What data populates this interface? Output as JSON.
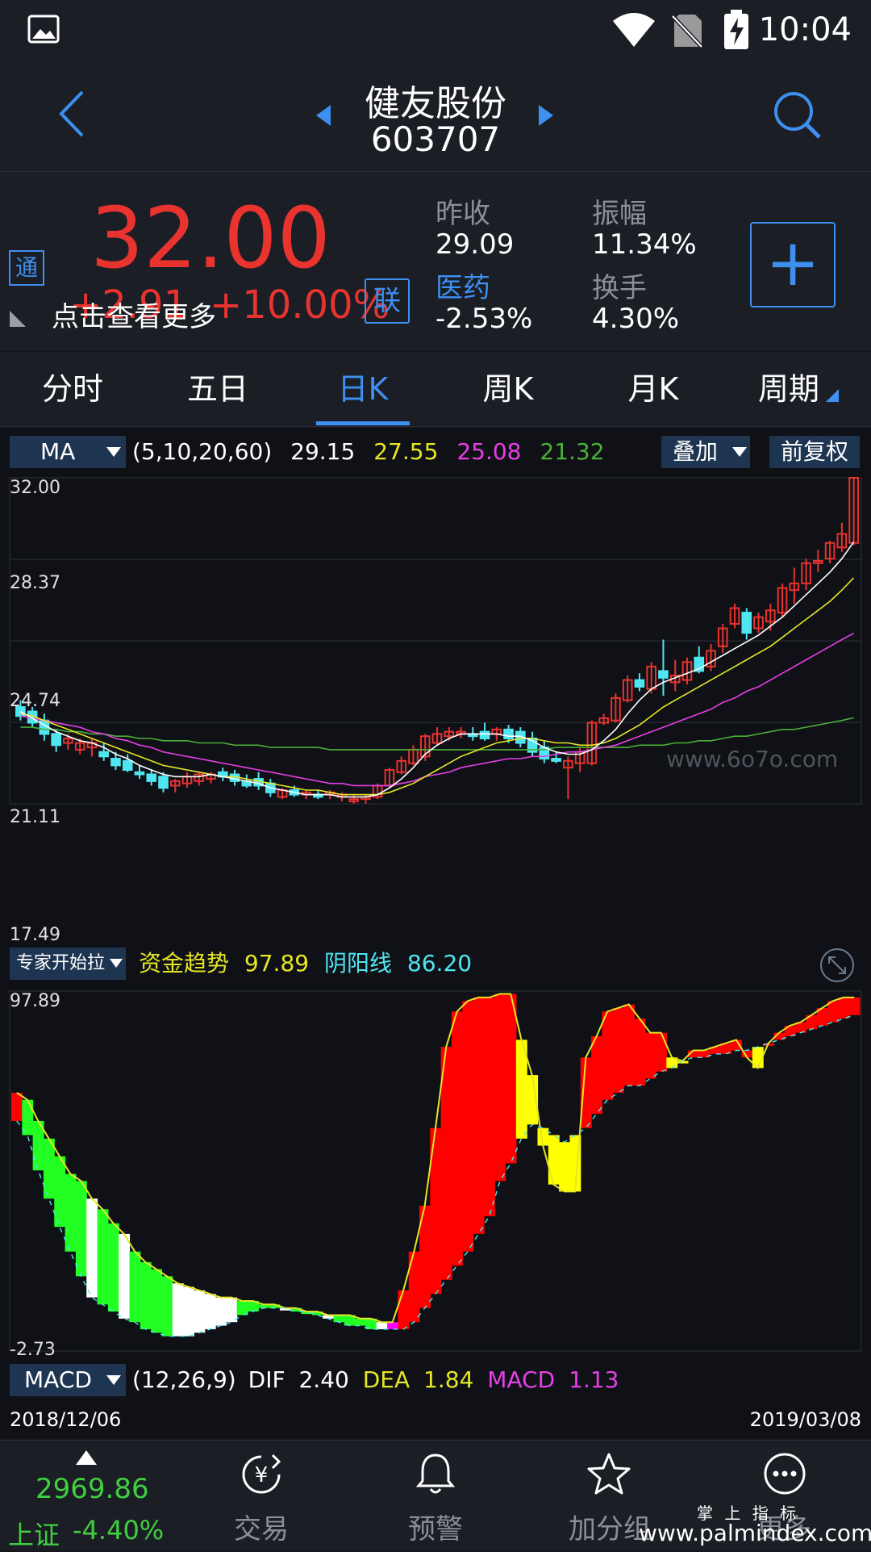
{
  "status_bar": {
    "time": "10:04"
  },
  "header": {
    "stock_name": "健友股份",
    "stock_code": "603707"
  },
  "quote": {
    "tong_badge": "通",
    "price": "32.00",
    "change": "+2.91",
    "change_pct": "+10.00%",
    "more_hint": "点击查看更多",
    "lian_badge": "联",
    "prev_close_label": "昨收",
    "prev_close": "29.09",
    "sector_label": "医药",
    "sector_change": "-2.53%",
    "amplitude_label": "振幅",
    "amplitude": "11.34%",
    "turnover_label": "换手",
    "turnover": "4.30%",
    "add_symbol": "+"
  },
  "tabs": [
    {
      "label": "分时"
    },
    {
      "label": "五日"
    },
    {
      "label": "日K"
    },
    {
      "label": "周K"
    },
    {
      "label": "月K"
    },
    {
      "label": "周期"
    }
  ],
  "ma_bar": {
    "indicator": "MA",
    "params": "(5,10,20,60)",
    "ma5": "29.15",
    "ma10": "27.55",
    "ma20": "25.08",
    "ma60": "21.32",
    "overlay_label": "叠加",
    "adjust_label": "前复权"
  },
  "colors": {
    "up": "#e8332f",
    "down": "#4fe6f2",
    "ma5": "#ffffff",
    "ma10": "#e6e625",
    "ma20": "#e63fe6",
    "ma60": "#4caf38",
    "accent": "#3d8ff0"
  },
  "price_axis": {
    "top": "32.00",
    "upper_mid": "28.37",
    "lower_mid": "24.74",
    "mid": "21.11",
    "bottom": "17.49"
  },
  "watermark": "www.6o7o.com",
  "indicator2": {
    "name": "专家开始拉",
    "trend_label": "资金趋势",
    "trend_value": "97.89",
    "yinyang_label": "阴阳线",
    "yinyang_value": "86.20",
    "axis_top": "97.89",
    "axis_bottom": "-2.73"
  },
  "macd_bar": {
    "indicator": "MACD",
    "params": "(12,26,9)",
    "dif_label": "DIF",
    "dif": "2.40",
    "dea_label": "DEA",
    "dea": "1.84",
    "macd_label": "MACD",
    "macd": "1.13"
  },
  "date_range": {
    "start": "2018/12/06",
    "end": "2019/03/08"
  },
  "bottom_nav": {
    "index_value": "2969.86",
    "index_name": "上证",
    "index_change": "-4.40%",
    "items": [
      {
        "label": "交易"
      },
      {
        "label": "预警"
      },
      {
        "label": "加分组"
      },
      {
        "label": "更多"
      }
    ]
  },
  "footer_watermark": {
    "line1": "掌 上 指 标",
    "line2": "www.palmindex.com"
  },
  "chart_data": {
    "type": "candlestick",
    "ylim": [
      17.49,
      32.0
    ],
    "candles": [
      {
        "o": 21.8,
        "h": 22.1,
        "l": 21.2,
        "c": 21.4
      },
      {
        "o": 21.6,
        "h": 21.8,
        "l": 20.9,
        "c": 21.1
      },
      {
        "o": 21.2,
        "h": 21.5,
        "l": 20.3,
        "c": 20.6
      },
      {
        "o": 20.6,
        "h": 20.8,
        "l": 19.8,
        "c": 20.1
      },
      {
        "o": 20.2,
        "h": 20.6,
        "l": 19.9,
        "c": 20.4
      },
      {
        "o": 19.9,
        "h": 20.4,
        "l": 19.7,
        "c": 20.2
      },
      {
        "o": 20.0,
        "h": 20.4,
        "l": 19.6,
        "c": 20.2
      },
      {
        "o": 19.8,
        "h": 20.2,
        "l": 19.4,
        "c": 19.6
      },
      {
        "o": 19.5,
        "h": 19.8,
        "l": 19.0,
        "c": 19.2
      },
      {
        "o": 19.4,
        "h": 19.7,
        "l": 18.9,
        "c": 19.0
      },
      {
        "o": 18.9,
        "h": 19.2,
        "l": 18.6,
        "c": 18.8
      },
      {
        "o": 18.8,
        "h": 19.0,
        "l": 18.3,
        "c": 18.5
      },
      {
        "o": 18.7,
        "h": 18.9,
        "l": 18.0,
        "c": 18.2
      },
      {
        "o": 18.3,
        "h": 18.6,
        "l": 18.0,
        "c": 18.5
      },
      {
        "o": 18.4,
        "h": 18.9,
        "l": 18.2,
        "c": 18.7
      },
      {
        "o": 18.5,
        "h": 18.9,
        "l": 18.3,
        "c": 18.8
      },
      {
        "o": 18.6,
        "h": 18.9,
        "l": 18.4,
        "c": 18.8
      },
      {
        "o": 18.9,
        "h": 19.1,
        "l": 18.5,
        "c": 18.7
      },
      {
        "o": 18.8,
        "h": 19.0,
        "l": 18.3,
        "c": 18.5
      },
      {
        "o": 18.5,
        "h": 18.8,
        "l": 18.2,
        "c": 18.3
      },
      {
        "o": 18.6,
        "h": 18.9,
        "l": 18.1,
        "c": 18.3
      },
      {
        "o": 18.4,
        "h": 18.6,
        "l": 17.8,
        "c": 18.0
      },
      {
        "o": 17.8,
        "h": 18.2,
        "l": 17.7,
        "c": 18.1
      },
      {
        "o": 18.1,
        "h": 18.3,
        "l": 17.8,
        "c": 17.9
      },
      {
        "o": 17.9,
        "h": 18.1,
        "l": 17.7,
        "c": 18.0
      },
      {
        "o": 17.9,
        "h": 18.1,
        "l": 17.7,
        "c": 17.8
      },
      {
        "o": 17.9,
        "h": 18.1,
        "l": 17.7,
        "c": 18.0
      },
      {
        "o": 17.8,
        "h": 18.0,
        "l": 17.6,
        "c": 17.9
      },
      {
        "o": 17.6,
        "h": 17.9,
        "l": 17.5,
        "c": 17.7
      },
      {
        "o": 17.7,
        "h": 17.9,
        "l": 17.5,
        "c": 17.8
      },
      {
        "o": 17.8,
        "h": 18.4,
        "l": 17.7,
        "c": 18.3
      },
      {
        "o": 18.3,
        "h": 19.1,
        "l": 18.2,
        "c": 19.0
      },
      {
        "o": 18.9,
        "h": 19.6,
        "l": 18.8,
        "c": 19.4
      },
      {
        "o": 19.3,
        "h": 20.1,
        "l": 19.2,
        "c": 19.9
      },
      {
        "o": 19.6,
        "h": 20.6,
        "l": 19.4,
        "c": 20.5
      },
      {
        "o": 20.2,
        "h": 20.9,
        "l": 20.1,
        "c": 20.6
      },
      {
        "o": 20.5,
        "h": 20.9,
        "l": 20.3,
        "c": 20.7
      },
      {
        "o": 20.6,
        "h": 20.9,
        "l": 20.4,
        "c": 20.7
      },
      {
        "o": 20.6,
        "h": 20.9,
        "l": 20.3,
        "c": 20.5
      },
      {
        "o": 20.7,
        "h": 21.1,
        "l": 20.3,
        "c": 20.4
      },
      {
        "o": 20.6,
        "h": 20.9,
        "l": 20.3,
        "c": 20.8
      },
      {
        "o": 20.8,
        "h": 21.0,
        "l": 20.2,
        "c": 20.4
      },
      {
        "o": 20.7,
        "h": 20.9,
        "l": 20.0,
        "c": 20.2
      },
      {
        "o": 20.4,
        "h": 20.7,
        "l": 19.6,
        "c": 19.8
      },
      {
        "o": 20.0,
        "h": 20.3,
        "l": 19.3,
        "c": 19.5
      },
      {
        "o": 19.5,
        "h": 19.8,
        "l": 19.3,
        "c": 19.4
      },
      {
        "o": 19.1,
        "h": 19.6,
        "l": 17.7,
        "c": 19.4
      },
      {
        "o": 19.3,
        "h": 20.0,
        "l": 18.9,
        "c": 19.8
      },
      {
        "o": 19.3,
        "h": 21.2,
        "l": 19.2,
        "c": 21.1
      },
      {
        "o": 21.1,
        "h": 21.5,
        "l": 21.0,
        "c": 21.3
      },
      {
        "o": 21.2,
        "h": 22.4,
        "l": 21.1,
        "c": 22.2
      },
      {
        "o": 22.1,
        "h": 23.2,
        "l": 22.0,
        "c": 23.0
      },
      {
        "o": 23.0,
        "h": 23.3,
        "l": 22.5,
        "c": 22.7
      },
      {
        "o": 22.6,
        "h": 23.8,
        "l": 22.4,
        "c": 23.6
      },
      {
        "o": 23.4,
        "h": 24.8,
        "l": 22.3,
        "c": 23.1
      },
      {
        "o": 22.9,
        "h": 23.9,
        "l": 22.5,
        "c": 23.2
      },
      {
        "o": 23.0,
        "h": 24.0,
        "l": 22.8,
        "c": 23.8
      },
      {
        "o": 24.0,
        "h": 24.5,
        "l": 23.3,
        "c": 23.4
      },
      {
        "o": 23.6,
        "h": 24.6,
        "l": 23.4,
        "c": 24.3
      },
      {
        "o": 24.5,
        "h": 25.5,
        "l": 24.2,
        "c": 25.3
      },
      {
        "o": 25.5,
        "h": 26.4,
        "l": 25.3,
        "c": 26.2
      },
      {
        "o": 26.0,
        "h": 26.2,
        "l": 24.8,
        "c": 25.1
      },
      {
        "o": 25.3,
        "h": 26.0,
        "l": 25.1,
        "c": 25.8
      },
      {
        "o": 25.6,
        "h": 26.4,
        "l": 25.2,
        "c": 26.1
      },
      {
        "o": 26.0,
        "h": 27.3,
        "l": 25.8,
        "c": 27.1
      },
      {
        "o": 27.0,
        "h": 28.0,
        "l": 26.4,
        "c": 27.3
      },
      {
        "o": 27.3,
        "h": 28.4,
        "l": 27.0,
        "c": 28.2
      },
      {
        "o": 28.2,
        "h": 28.8,
        "l": 27.8,
        "c": 28.3
      },
      {
        "o": 28.4,
        "h": 29.2,
        "l": 28.2,
        "c": 29.1
      },
      {
        "o": 28.9,
        "h": 30.0,
        "l": 28.7,
        "c": 29.5
      },
      {
        "o": 29.1,
        "h": 32.0,
        "l": 29.0,
        "c": 32.0
      }
    ],
    "ma5": [
      21.6,
      21.3,
      21.0,
      20.7,
      20.5,
      20.3,
      20.2,
      20.0,
      19.7,
      19.5,
      19.2,
      19.0,
      18.8,
      18.7,
      18.7,
      18.7,
      18.8,
      18.7,
      18.6,
      18.5,
      18.4,
      18.2,
      18.1,
      18.0,
      17.9,
      17.9,
      17.9,
      17.8,
      17.8,
      17.8,
      17.9,
      18.2,
      18.6,
      19.1,
      19.7,
      20.1,
      20.4,
      20.6,
      20.6,
      20.6,
      20.6,
      20.5,
      20.5,
      20.3,
      20.0,
      19.8,
      19.7,
      19.7,
      19.9,
      20.3,
      20.8,
      21.5,
      22.1,
      22.6,
      22.9,
      23.1,
      23.3,
      23.5,
      23.8,
      24.1,
      24.4,
      24.7,
      25.0,
      25.4,
      25.8,
      26.3,
      26.8,
      27.3,
      27.8,
      28.4,
      29.15
    ],
    "ma10": [
      21.5,
      21.4,
      21.2,
      21.0,
      20.8,
      20.6,
      20.4,
      20.2,
      20.0,
      19.8,
      19.6,
      19.4,
      19.2,
      19.1,
      19.0,
      18.9,
      18.8,
      18.7,
      18.7,
      18.6,
      18.5,
      18.4,
      18.3,
      18.2,
      18.1,
      18.1,
      18.0,
      17.9,
      17.9,
      17.9,
      17.9,
      18.0,
      18.2,
      18.4,
      18.7,
      19.0,
      19.3,
      19.6,
      19.8,
      20.0,
      20.2,
      20.3,
      20.4,
      20.4,
      20.3,
      20.2,
      20.2,
      20.1,
      20.1,
      20.2,
      20.4,
      20.7,
      21.0,
      21.4,
      21.8,
      22.1,
      22.4,
      22.7,
      23.0,
      23.3,
      23.6,
      23.9,
      24.2,
      24.5,
      24.9,
      25.3,
      25.7,
      26.1,
      26.5,
      27.0,
      27.55
    ],
    "ma20": [
      21.4,
      21.3,
      21.2,
      21.1,
      21.0,
      20.9,
      20.7,
      20.6,
      20.4,
      20.3,
      20.1,
      20.0,
      19.8,
      19.7,
      19.6,
      19.5,
      19.4,
      19.3,
      19.2,
      19.1,
      19.0,
      18.9,
      18.8,
      18.7,
      18.6,
      18.5,
      18.4,
      18.4,
      18.3,
      18.3,
      18.3,
      18.3,
      18.4,
      18.5,
      18.7,
      18.8,
      18.9,
      19.1,
      19.2,
      19.3,
      19.4,
      19.5,
      19.5,
      19.6,
      19.6,
      19.7,
      19.8,
      19.8,
      19.9,
      20.0,
      20.1,
      20.3,
      20.5,
      20.7,
      20.9,
      21.1,
      21.3,
      21.5,
      21.7,
      22.0,
      22.2,
      22.5,
      22.7,
      23.0,
      23.3,
      23.6,
      23.9,
      24.2,
      24.5,
      24.8,
      25.08
    ],
    "ma60": [
      20.9,
      20.9,
      20.8,
      20.8,
      20.7,
      20.7,
      20.6,
      20.6,
      20.5,
      20.5,
      20.4,
      20.4,
      20.3,
      20.3,
      20.3,
      20.2,
      20.2,
      20.2,
      20.1,
      20.1,
      20.1,
      20.0,
      20.0,
      20.0,
      20.0,
      20.0,
      19.9,
      19.9,
      19.9,
      19.9,
      19.9,
      19.9,
      19.9,
      19.9,
      19.9,
      19.9,
      19.9,
      19.9,
      19.9,
      19.9,
      19.9,
      19.9,
      19.9,
      19.9,
      19.9,
      20.0,
      20.0,
      20.0,
      20.0,
      20.0,
      20.0,
      20.0,
      20.1,
      20.1,
      20.1,
      20.2,
      20.2,
      20.3,
      20.3,
      20.4,
      20.5,
      20.5,
      20.6,
      20.7,
      20.8,
      20.8,
      20.9,
      21.0,
      21.1,
      21.2,
      21.32
    ],
    "indicator_bars": {
      "ylim": [
        -2.73,
        97.89
      ],
      "top": [
        70,
        68,
        62,
        57,
        52,
        47,
        45,
        40,
        37,
        33,
        30,
        25,
        22,
        20,
        18,
        16,
        15,
        14,
        13,
        12,
        12,
        11,
        11,
        10,
        10,
        9,
        9,
        8,
        8,
        7,
        7,
        7,
        6,
        6,
        5,
        5,
        14,
        25,
        38,
        60,
        83,
        93,
        96,
        97,
        97,
        98,
        98,
        85,
        75,
        55,
        44,
        42,
        42,
        80,
        86,
        93,
        94,
        95,
        91,
        87,
        87,
        80,
        79,
        82,
        82,
        83,
        84,
        85,
        80,
        77,
        84,
        87,
        89,
        90,
        92,
        94,
        96,
        97,
        97
      ],
      "bottom": [
        62,
        58,
        48,
        40,
        32,
        25,
        18,
        12,
        10,
        8,
        6,
        5,
        3,
        2,
        1,
        1,
        1,
        2,
        3,
        4,
        5,
        7,
        8,
        9,
        9,
        9,
        8,
        8,
        7,
        6,
        5,
        4,
        4,
        3,
        3,
        3,
        3,
        5,
        9,
        13,
        17,
        21,
        25,
        30,
        35,
        45,
        50,
        57,
        61,
        60,
        58,
        56,
        58,
        60,
        64,
        68,
        70,
        72,
        72,
        74,
        76,
        77,
        79,
        80,
        80,
        81,
        81,
        82,
        82,
        83,
        84,
        85,
        86,
        87,
        88,
        89,
        90,
        91,
        92
      ],
      "colors": [
        "red",
        "green",
        "green",
        "green",
        "green",
        "green",
        "green",
        "white",
        "green",
        "green",
        "white",
        "green",
        "green",
        "green",
        "green",
        "white",
        "white",
        "white",
        "white",
        "white",
        "white",
        "green",
        "green",
        "green",
        "green",
        "white",
        "green",
        "green",
        "green",
        "white",
        "green",
        "green",
        "green",
        "green",
        "white",
        "magenta",
        "red",
        "red",
        "red",
        "red",
        "red",
        "red",
        "red",
        "red",
        "red",
        "red",
        "red",
        "yellow",
        "yellow",
        "yellow",
        "yellow",
        "yellow",
        "yellow",
        "red",
        "red",
        "red",
        "red",
        "red",
        "red",
        "red",
        "red",
        "yellow",
        "yellow",
        "red",
        "red",
        "red",
        "red",
        "red",
        "red",
        "yellow",
        "red",
        "red",
        "red",
        "red",
        "red",
        "red",
        "red",
        "red",
        "red"
      ]
    }
  }
}
